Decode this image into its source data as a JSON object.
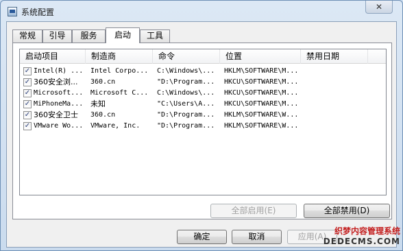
{
  "window": {
    "title": "系统配置",
    "close_label": "✕"
  },
  "tabs": [
    {
      "label": "常规"
    },
    {
      "label": "引导"
    },
    {
      "label": "服务"
    },
    {
      "label": "启动"
    },
    {
      "label": "工具"
    }
  ],
  "active_tab": "启动",
  "startup_list": {
    "columns": [
      "启动项目",
      "制造商",
      "命令",
      "位置",
      "禁用日期"
    ],
    "rows": [
      {
        "checked": true,
        "item": "Intel(R) ...",
        "manufacturer": "Intel Corpo...",
        "command": "C:\\Windows\\...",
        "location": "HKLM\\SOFTWARE\\M..."
      },
      {
        "checked": true,
        "item": "360安全浏...",
        "manufacturer": "360.cn",
        "command": "\"D:\\Program...",
        "location": "HKCU\\SOFTWARE\\M..."
      },
      {
        "checked": true,
        "item": "Microsoft...",
        "manufacturer": "Microsoft C...",
        "command": "C:\\Windows\\...",
        "location": "HKCU\\SOFTWARE\\M..."
      },
      {
        "checked": true,
        "item": "MiPhoneMa...",
        "manufacturer": "未知",
        "command": "\"C:\\Users\\A...",
        "location": "HKCU\\SOFTWARE\\M..."
      },
      {
        "checked": true,
        "item": "360安全卫士",
        "manufacturer": "360.cn",
        "command": "\"D:\\Program...",
        "location": "HKLM\\SOFTWARE\\W..."
      },
      {
        "checked": true,
        "item": "VMware Wo...",
        "manufacturer": "VMware, Inc.",
        "command": "\"D:\\Program...",
        "location": "HKLM\\SOFTWARE\\W..."
      }
    ]
  },
  "buttons": {
    "enable_all": "全部启用(E)",
    "disable_all": "全部禁用(D)",
    "ok": "确定",
    "cancel": "取消",
    "apply": "应用(A)"
  },
  "watermark": {
    "line1": "织梦内容管理系统",
    "line2": "DEDECMS.COM"
  }
}
